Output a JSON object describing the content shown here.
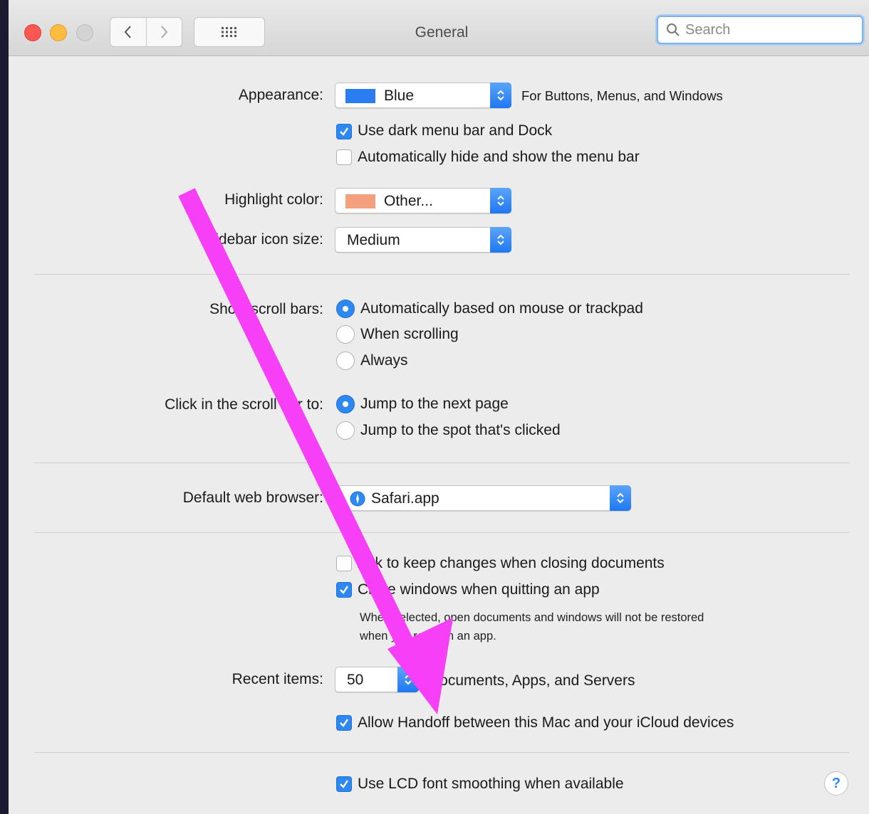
{
  "window": {
    "title": "General",
    "search": {
      "placeholder": "Search",
      "value": ""
    }
  },
  "appearance": {
    "label": "Appearance:",
    "value": "Blue",
    "swatch_color": "#2a7df1",
    "hint": "For Buttons, Menus, and Windows",
    "dark_menu_label": "Use dark menu bar and Dock",
    "dark_menu_checked": true,
    "auto_hide_label": "Automatically hide and show the menu bar",
    "auto_hide_checked": false
  },
  "highlight": {
    "label": "Highlight color:",
    "value": "Other...",
    "swatch_color": "#f5a07c"
  },
  "sidebar": {
    "label": "Sidebar icon size:",
    "value": "Medium"
  },
  "scroll_bars": {
    "label": "Show scroll bars:",
    "options": [
      "Automatically based on mouse or trackpad",
      "When scrolling",
      "Always"
    ],
    "selected_index": 0
  },
  "scroll_click": {
    "label": "Click in the scroll bar to:",
    "options": [
      "Jump to the next page",
      "Jump to the spot that's clicked"
    ],
    "selected_index": 0
  },
  "browser": {
    "label": "Default web browser:",
    "value": "Safari.app"
  },
  "documents": {
    "ask_keep_label": "Ask to keep changes when closing documents",
    "ask_keep_checked": false,
    "close_windows_label": "Close windows when quitting an app",
    "close_windows_checked": true,
    "note_line1": "When selected, open documents and windows will not be restored",
    "note_line2": "when you re-open an app."
  },
  "recent": {
    "label": "Recent items:",
    "value": "50",
    "suffix": "Documents, Apps, and Servers"
  },
  "handoff": {
    "label": "Allow Handoff between this Mac and your iCloud devices",
    "checked": true
  },
  "lcd": {
    "label": "Use LCD font smoothing when available",
    "checked": true
  },
  "help": {
    "label": "?"
  },
  "annotation": {
    "arrow_color": "#f63ff6"
  }
}
